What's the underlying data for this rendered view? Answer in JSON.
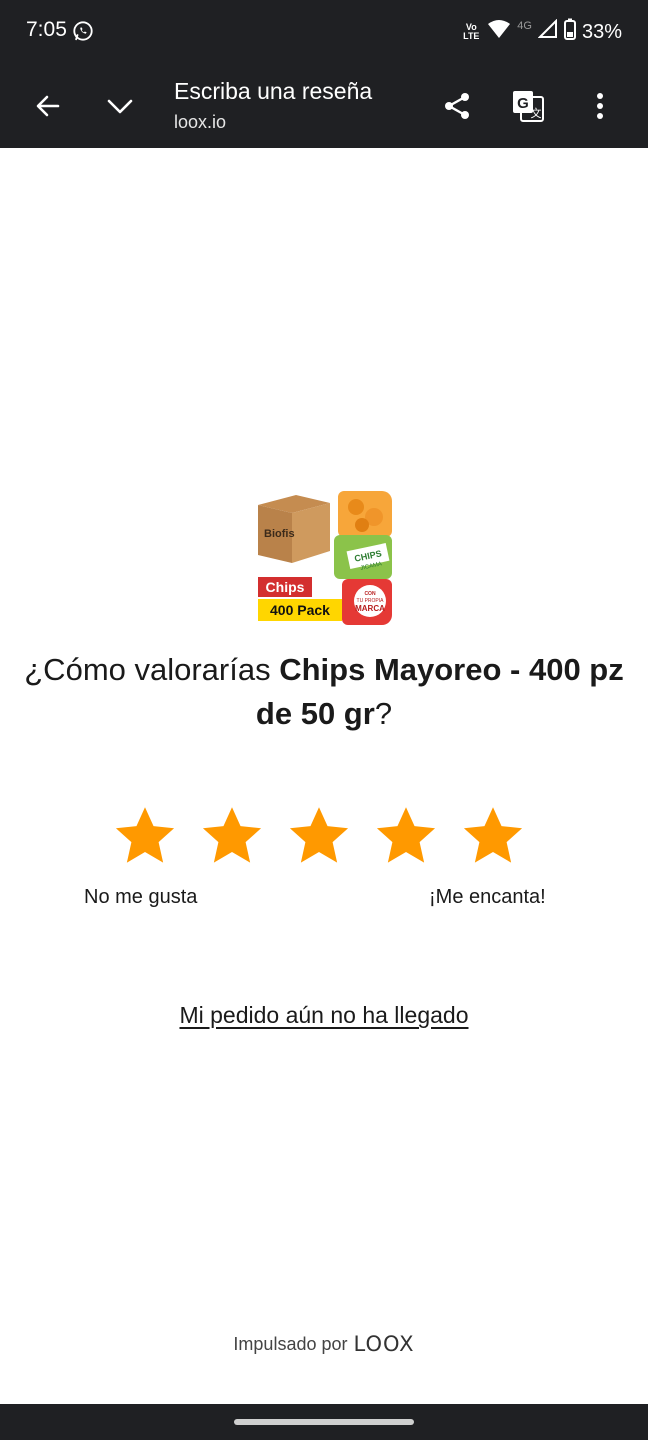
{
  "status_bar": {
    "time": "7:05",
    "volte_top": "Vo",
    "volte_bottom": "LTE",
    "network": "4G",
    "battery": "33%"
  },
  "toolbar": {
    "title": "Escriba una reseña",
    "domain": "loox.io"
  },
  "product": {
    "image_alt": "Chips 400 Pack",
    "image_texts": {
      "brand": "Biofis",
      "badge_top": "Chips",
      "badge_bottom": "400 Pack",
      "bag_label": "CHIPS",
      "bag_label_sub": "JICAMA",
      "stamp_top": "CON",
      "stamp_mid": "TU PROPIA",
      "stamp_bottom": "MARCA"
    }
  },
  "review": {
    "question_prefix": "¿Cómo valorarías ",
    "product_name": "Chips Mayoreo - 400 pz de 50 gr",
    "question_suffix": "?",
    "star_count": 5,
    "star_color": "#ff9900",
    "label_low": "No me gusta",
    "label_high": "¡Me encanta!",
    "not_arrived_link": "Mi pedido aún no ha llegado"
  },
  "footer": {
    "powered_by": "Impulsado por",
    "brand_logo": "LOOX"
  },
  "colors": {
    "chrome_bg": "#1f2023",
    "page_bg": "#ffffff",
    "text": "#1a1a1a",
    "star": "#ff9900"
  }
}
